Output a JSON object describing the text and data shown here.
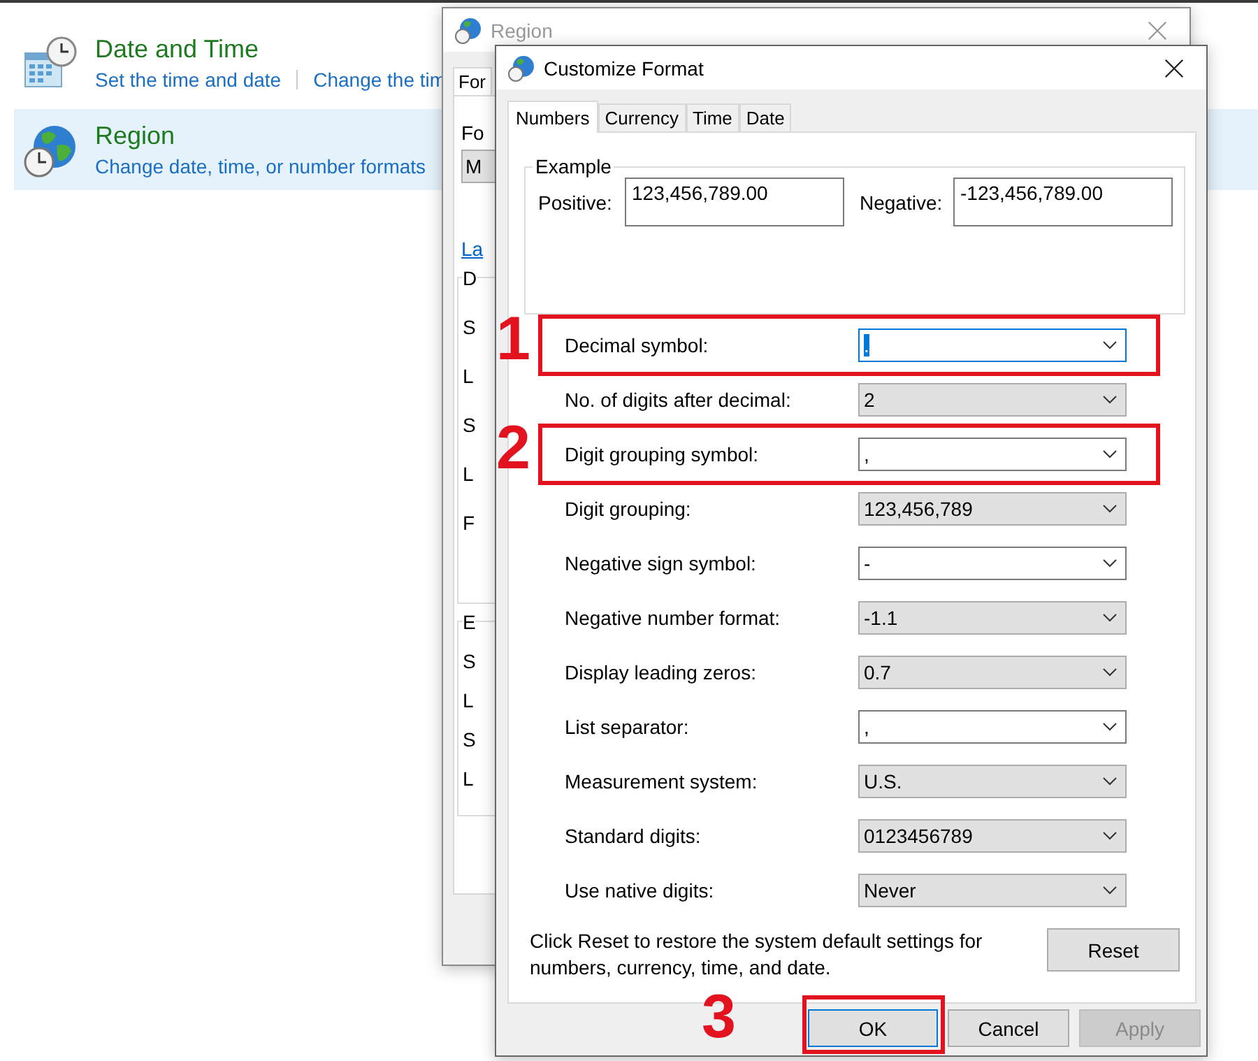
{
  "control_panel": {
    "items": [
      {
        "kind": "datetime",
        "title": "Date and Time",
        "links": [
          "Set the time and date",
          "Change the tim"
        ],
        "selected": false
      },
      {
        "kind": "region",
        "title": "Region",
        "links": [
          "Change date, time, or number formats"
        ],
        "selected": true
      }
    ]
  },
  "region_dialog": {
    "title": "Region",
    "active": false,
    "tab": "For",
    "format_label": "Fo",
    "format_value": "M",
    "link": "La",
    "groups": [
      {
        "legend": "D",
        "items": [
          "S",
          "L",
          "S",
          "L",
          "F"
        ]
      },
      {
        "legend": "E",
        "items": [
          "S",
          "L",
          "S",
          "L"
        ]
      }
    ]
  },
  "customize_dialog": {
    "title": "Customize Format",
    "active": true,
    "tabs": [
      {
        "label": "Numbers",
        "selected": true
      },
      {
        "label": "Currency",
        "selected": false
      },
      {
        "label": "Time",
        "selected": false
      },
      {
        "label": "Date",
        "selected": false
      }
    ],
    "example": {
      "legend": "Example",
      "positive_label": "Positive:",
      "positive_value": "123,456,789.00",
      "negative_label": "Negative:",
      "negative_value": "-123,456,789.00"
    },
    "settings": [
      {
        "label": "Decimal symbol:",
        "value": ".",
        "kind": "editable",
        "focused": true,
        "annotation": "1"
      },
      {
        "label": "No. of digits after decimal:",
        "value": "2",
        "kind": "list",
        "focused": false
      },
      {
        "label": "Digit grouping symbol:",
        "value": ",",
        "kind": "editable",
        "focused": false,
        "annotation": "2"
      },
      {
        "label": "Digit grouping:",
        "value": "123,456,789",
        "kind": "list",
        "focused": false
      },
      {
        "label": "Negative sign symbol:",
        "value": "-",
        "kind": "editable",
        "focused": false
      },
      {
        "label": "Negative number format:",
        "value": "-1.1",
        "kind": "list",
        "focused": false
      },
      {
        "label": "Display leading zeros:",
        "value": "0.7",
        "kind": "list",
        "focused": false
      },
      {
        "label": "List separator:",
        "value": ",",
        "kind": "editable",
        "focused": false
      },
      {
        "label": "Measurement system:",
        "value": "U.S.",
        "kind": "list",
        "focused": false
      },
      {
        "label": "Standard digits:",
        "value": "0123456789",
        "kind": "list",
        "focused": false
      },
      {
        "label": "Use native digits:",
        "value": "Never",
        "kind": "list",
        "focused": false
      }
    ],
    "note": "Click Reset to restore the system default settings for numbers, currency, time, and date.",
    "reset": "Reset",
    "buttons": [
      {
        "label": "OK",
        "default": true,
        "disabled": false,
        "annotation": "3"
      },
      {
        "label": "Cancel",
        "default": false,
        "disabled": false
      },
      {
        "label": "Apply",
        "default": false,
        "disabled": true
      }
    ]
  }
}
